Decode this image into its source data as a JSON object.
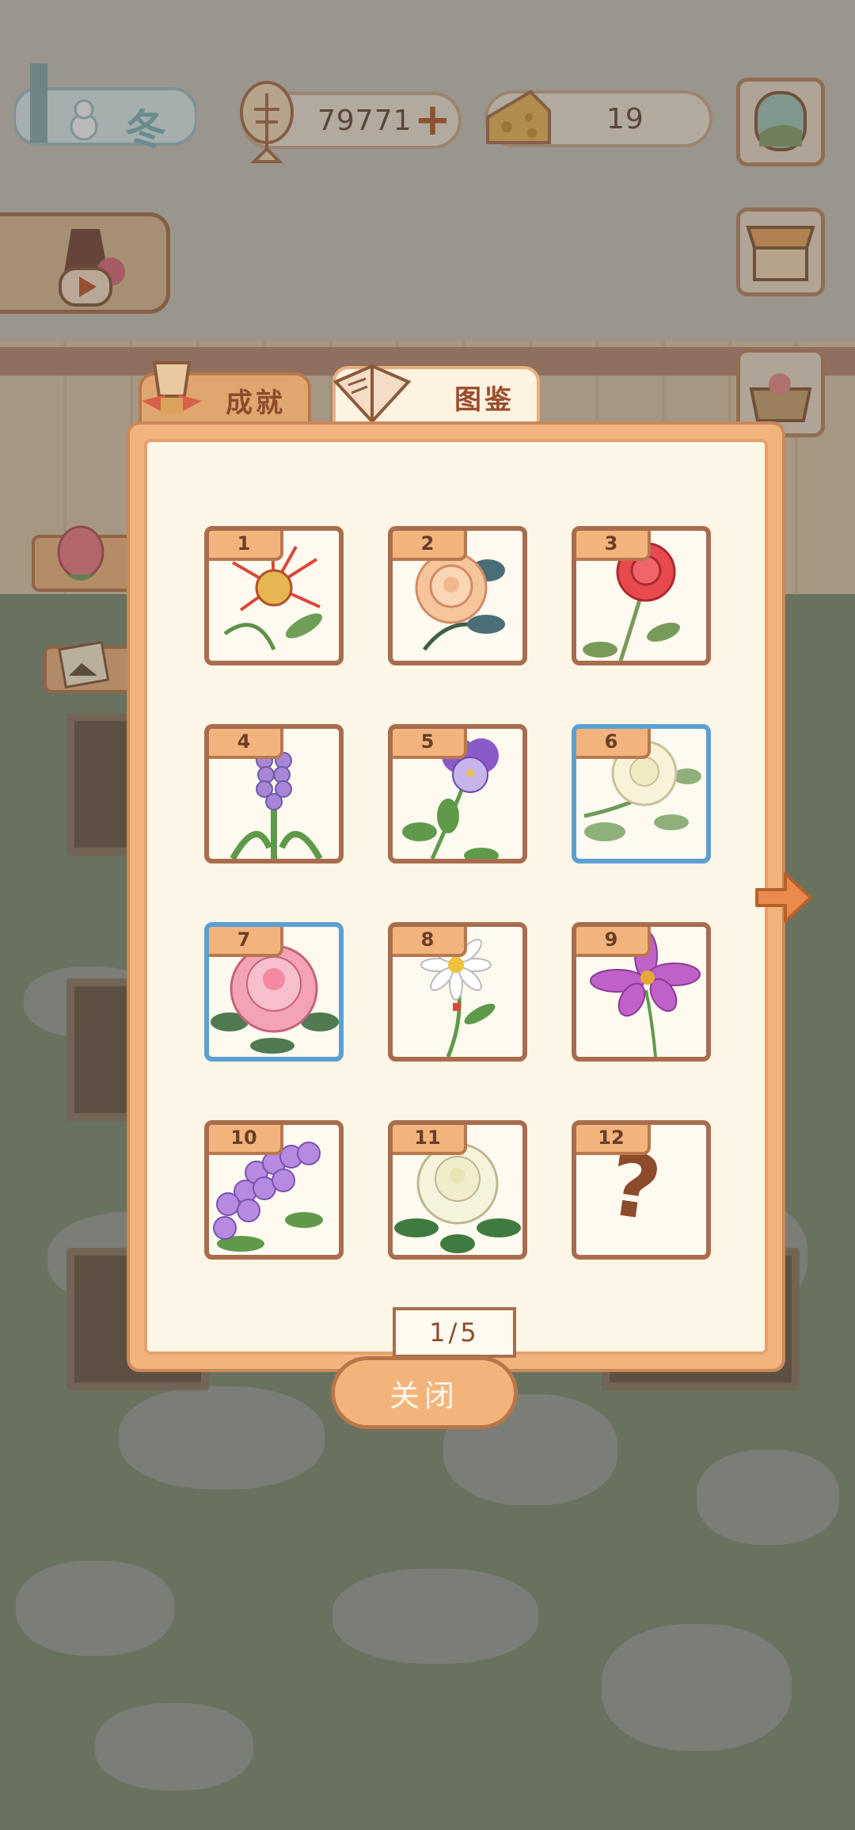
{
  "hud": {
    "season_label": "冬",
    "fish_currency": "79771",
    "cheese_currency": "19"
  },
  "tabs": {
    "achievements": "成就",
    "gallery": "图鉴"
  },
  "gallery": {
    "page_indicator": "1/5",
    "cards": [
      {
        "number": "1",
        "flower": "spider-lily",
        "highlight": false
      },
      {
        "number": "2",
        "flower": "peach-rose",
        "highlight": false
      },
      {
        "number": "3",
        "flower": "red-rose",
        "highlight": false
      },
      {
        "number": "4",
        "flower": "hyacinth",
        "highlight": false
      },
      {
        "number": "5",
        "flower": "pansy",
        "highlight": false
      },
      {
        "number": "6",
        "flower": "white-gardenia",
        "highlight": true
      },
      {
        "number": "7",
        "flower": "peony",
        "highlight": true
      },
      {
        "number": "8",
        "flower": "daisy",
        "highlight": false
      },
      {
        "number": "9",
        "flower": "cosmos",
        "highlight": false
      },
      {
        "number": "10",
        "flower": "lilac",
        "highlight": false
      },
      {
        "number": "11",
        "flower": "gardenia",
        "highlight": false
      },
      {
        "number": "12",
        "flower": "unknown",
        "highlight": false
      }
    ],
    "locked_mark": "?"
  },
  "buttons": {
    "close": "关闭"
  },
  "colors": {
    "panel": "#f2b47c",
    "panel_inner": "#fdf6e6",
    "card_border": "#a86d4e",
    "card_highlight_border": "#5b9fd3",
    "accent_text": "#8d4b2c"
  }
}
